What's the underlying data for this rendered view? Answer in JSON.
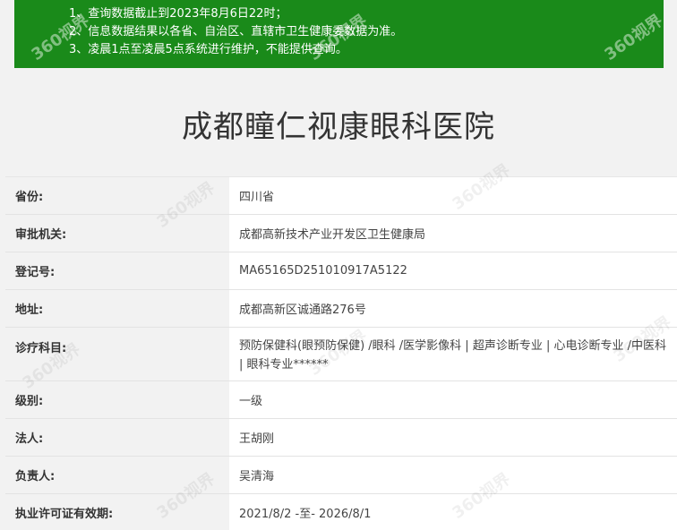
{
  "notice": {
    "lines": [
      "1、查询数据截止到2023年8月6日22时；",
      "2、信息数据结果以各省、自治区、直辖市卫生健康委数据为准。",
      "3、凌晨1点至凌晨5点系统进行维护，不能提供查询。"
    ]
  },
  "watermark_text": "360视界",
  "hospital_name": "成都瞳仁视康眼科医院",
  "rows": [
    {
      "label": "省份:",
      "value": "四川省"
    },
    {
      "label": "审批机关:",
      "value": "成都高新技术产业开发区卫生健康局"
    },
    {
      "label": "登记号:",
      "value": "MA65165D251010917A5122"
    },
    {
      "label": "地址:",
      "value": "成都高新区诚通路276号"
    },
    {
      "label": "诊疗科目:",
      "value": "预防保健科(眼预防保健) /眼科 /医学影像科  |  超声诊断专业  |  心电诊断专业 /中医科  |  眼科专业******"
    },
    {
      "label": "级别:",
      "value": "一级"
    },
    {
      "label": "法人:",
      "value": "王胡刚"
    },
    {
      "label": "负责人:",
      "value": "吴清海"
    },
    {
      "label": "执业许可证有效期:",
      "value": "2021/8/2 -至- 2026/8/1"
    }
  ]
}
